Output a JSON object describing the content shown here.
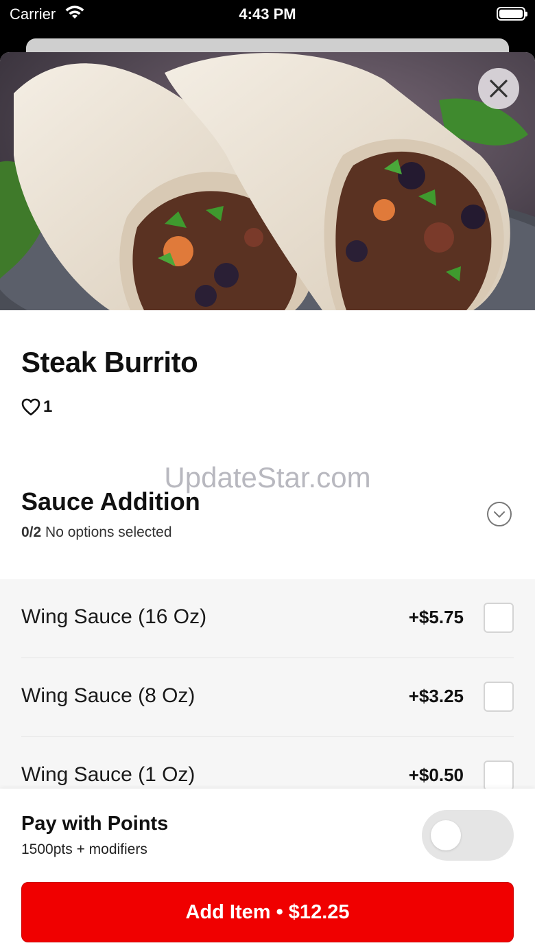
{
  "status_bar": {
    "carrier": "Carrier",
    "time": "4:43 PM"
  },
  "hero": {
    "icon": "burrito-photo",
    "close_icon": "close-icon"
  },
  "item": {
    "title": "Steak Burrito",
    "like_icon": "heart-icon",
    "likes": "1"
  },
  "watermark": "UpdateStar.com",
  "section": {
    "title": "Sauce Addition",
    "selected_count": "0/2",
    "selected_text": "No options selected",
    "expand_icon": "chevron-down-circle-icon"
  },
  "options": [
    {
      "label": "Wing Sauce (16 Oz)",
      "price": "+$5.75",
      "checked": false
    },
    {
      "label": "Wing Sauce (8 Oz)",
      "price": "+$3.25",
      "checked": false
    },
    {
      "label": "Wing Sauce (1 Oz)",
      "price": "+$0.50",
      "checked": false
    }
  ],
  "footer": {
    "points_title": "Pay with Points",
    "points_sub": "1500pts + modifiers",
    "points_enabled": false,
    "add_button": "Add Item • $12.25"
  },
  "colors": {
    "accent": "#f00000",
    "toggle_off": "#e5e5e5",
    "options_bg": "#f6f6f6"
  }
}
